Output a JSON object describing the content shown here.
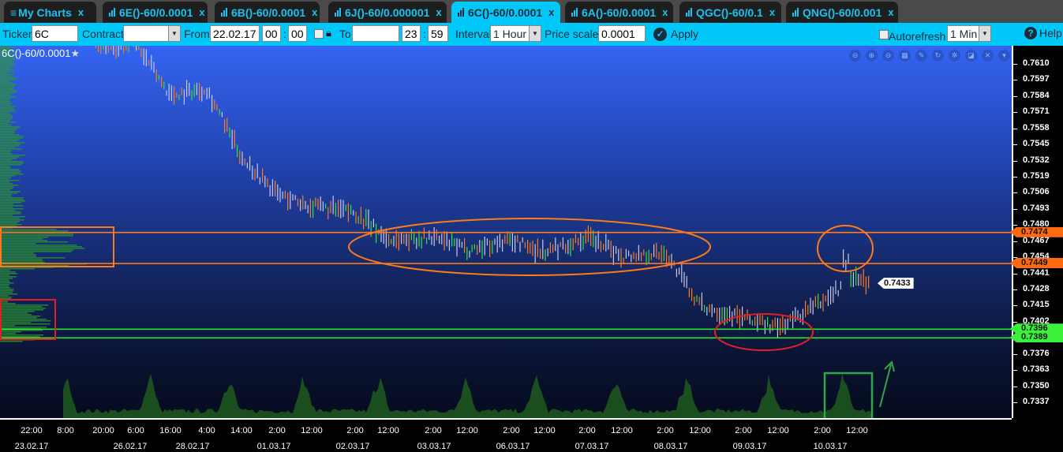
{
  "tabs": [
    {
      "label": "My Charts",
      "icon": "menu-icon",
      "active": false
    },
    {
      "label": "6E()-60/0.0001",
      "icon": "bar-chart-icon",
      "active": false
    },
    {
      "label": "6B()-60/0.0001",
      "icon": "bar-chart-icon",
      "active": false
    },
    {
      "label": "6J()-60/0.000001",
      "icon": "bar-chart-icon",
      "active": false
    },
    {
      "label": "6C()-60/0.0001",
      "icon": "bar-chart-icon",
      "active": true
    },
    {
      "label": "6A()-60/0.0001",
      "icon": "bar-chart-icon",
      "active": false
    },
    {
      "label": "QGC()-60/0.1",
      "icon": "bar-chart-icon",
      "active": false
    },
    {
      "label": "QNG()-60/0.001",
      "icon": "bar-chart-icon",
      "active": false
    }
  ],
  "tab_close": "x",
  "toolbar": {
    "ticker_label": "Ticker",
    "ticker_value": "6C",
    "contract_label": "Contract",
    "contract_value": "",
    "from_label": "From",
    "from_date": "22.02.17",
    "from_hour": "00",
    "from_min": "00",
    "colon": ":",
    "to_label": "To",
    "to_date": "",
    "to_hour": "23",
    "to_min": "59",
    "interval_label": "Interval",
    "interval_value": "1 Hour",
    "price_scale_label": "Price scale",
    "price_scale_value": "0.0001",
    "apply_label": "Apply",
    "autorefresh_label": "Autorefresh",
    "autorefresh_checked": false,
    "autorefresh_value": "1 Min",
    "help_label": "Help"
  },
  "chart": {
    "title": "6C()-60/0.0001",
    "tool_icons": [
      "zoom-reset-icon",
      "zoom-in-icon",
      "zoom-out-icon",
      "grid-icon",
      "pencil-icon",
      "refresh-icon",
      "settings-icon",
      "popout-icon",
      "close-icon",
      "dropdown-icon"
    ],
    "colors": {
      "orange": "#ff7a1a",
      "green": "#35e035",
      "red": "#e02020",
      "up_bar": "#35e035",
      "down_bar": "#ff7a1a",
      "neutral_bar": "#c8c8e8"
    }
  },
  "chart_data": {
    "type": "ohlc",
    "y_ticks": [
      "0.7610",
      "0.7597",
      "0.7584",
      "0.7571",
      "0.7558",
      "0.7545",
      "0.7532",
      "0.7519",
      "0.7506",
      "0.7493",
      "0.7480",
      "0.7467",
      "0.7454",
      "0.7441",
      "0.7428",
      "0.7415",
      "0.7402",
      "0.7389",
      "0.7376",
      "0.7363",
      "0.7350",
      "0.7337"
    ],
    "ylim": [
      0.733,
      0.7633
    ],
    "x_time_ticks": [
      "22:00",
      "8:00",
      "20:00",
      "6:00",
      "16:00",
      "4:00",
      "14:00",
      "2:00",
      "12:00",
      "2:00",
      "12:00",
      "2:00",
      "12:00",
      "2:00",
      "12:00",
      "2:00",
      "12:00",
      "2:00",
      "12:00",
      "2:00",
      "12:00",
      "2:00",
      "12:00"
    ],
    "x_date_ticks": [
      "23.02.17",
      "26.02.17",
      "28.02.17",
      "01.03.17",
      "02.03.17",
      "03.03.17",
      "06.03.17",
      "07.03.17",
      "08.03.17",
      "09.03.17",
      "10.03.17"
    ],
    "price_path": [
      {
        "t": "24.02 08:00",
        "p": 0.764
      },
      {
        "t": "24.02 20:00",
        "p": 0.7625
      },
      {
        "t": "27.02 06:00",
        "p": 0.7626
      },
      {
        "t": "27.02 16:00",
        "p": 0.7585
      },
      {
        "t": "28.02 04:00",
        "p": 0.759
      },
      {
        "t": "28.02 14:00",
        "p": 0.7535
      },
      {
        "t": "01.03 02:00",
        "p": 0.7505
      },
      {
        "t": "01.03 12:00",
        "p": 0.7495
      },
      {
        "t": "02.03 02:00",
        "p": 0.749
      },
      {
        "t": "02.03 12:00",
        "p": 0.7468
      },
      {
        "t": "03.03 02:00",
        "p": 0.747
      },
      {
        "t": "03.03 12:00",
        "p": 0.746
      },
      {
        "t": "06.03 02:00",
        "p": 0.7468
      },
      {
        "t": "06.03 12:00",
        "p": 0.7458
      },
      {
        "t": "07.03 02:00",
        "p": 0.747
      },
      {
        "t": "07.03 12:00",
        "p": 0.7455
      },
      {
        "t": "08.03 02:00",
        "p": 0.7458
      },
      {
        "t": "08.03 12:00",
        "p": 0.7415
      },
      {
        "t": "09.03 02:00",
        "p": 0.7405
      },
      {
        "t": "09.03 12:00",
        "p": 0.7397
      },
      {
        "t": "10.03 02:00",
        "p": 0.7418
      },
      {
        "t": "10.03 12:00",
        "p": 0.744
      }
    ],
    "last_price": "0.7433",
    "levels": [
      {
        "value": "0.7474",
        "color": "orange"
      },
      {
        "value": "0.7449",
        "color": "orange"
      },
      {
        "value": "0.7396",
        "color": "green"
      },
      {
        "value": "0.7389",
        "color": "green"
      }
    ]
  }
}
